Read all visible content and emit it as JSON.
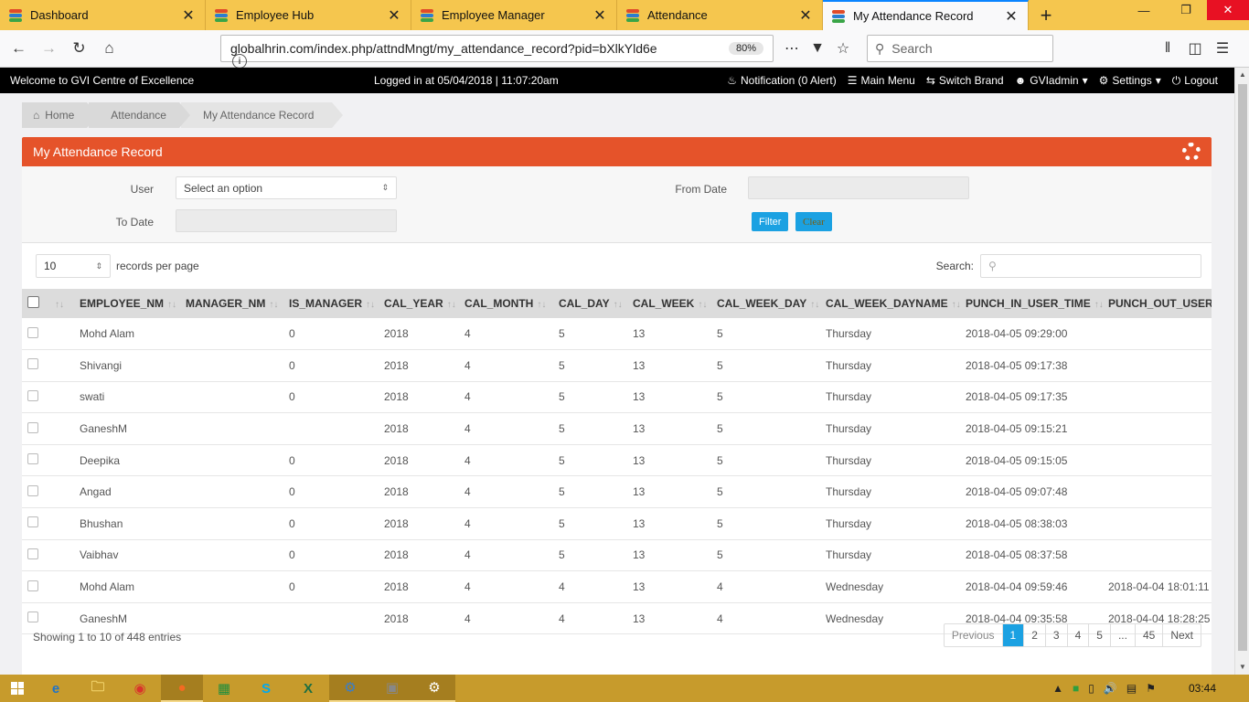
{
  "browser": {
    "tabs": [
      {
        "title": "Dashboard",
        "active": false
      },
      {
        "title": "Employee Hub",
        "active": false
      },
      {
        "title": "Employee Manager",
        "active": false
      },
      {
        "title": "Attendance",
        "active": false
      },
      {
        "title": "My Attendance Record",
        "active": true
      }
    ],
    "url": "globalhrin.com/index.php/attndMngt/my_attendance_record?pid=bXlkYld6e",
    "zoom": "80%",
    "search_placeholder": "Search"
  },
  "header": {
    "welcome": "Welcome to GVI Centre of Excellence",
    "logged_in": "Logged in at 05/04/2018 | 11:07:20am",
    "notification": "Notification (0 Alert)",
    "main_menu": "Main Menu",
    "switch_brand": "Switch Brand",
    "user": "GVIadmin",
    "settings": "Settings",
    "logout": "Logout"
  },
  "breadcrumb": [
    "Home",
    "Attendance",
    "My Attendance Record"
  ],
  "panel": {
    "title": "My Attendance Record",
    "accent": "#e5532a"
  },
  "filters": {
    "user_label": "User",
    "user_value": "Select an option",
    "from_label": "From Date",
    "to_label": "To Date",
    "filter_button": "Filter",
    "clear_button": "Clear"
  },
  "table": {
    "page_length": "10",
    "length_label": "records per page",
    "search_label": "Search:",
    "columns": [
      "EMPLOYEE_NM",
      "MANAGER_NM",
      "IS_MANAGER",
      "CAL_YEAR",
      "CAL_MONTH",
      "CAL_DAY",
      "CAL_WEEK",
      "CAL_WEEK_DAY",
      "CAL_WEEK_DAYNAME",
      "PUNCH_IN_USER_TIME",
      "PUNCH_OUT_USER_T"
    ],
    "rows": [
      [
        "Mohd Alam",
        "",
        "0",
        "2018",
        "4",
        "5",
        "13",
        "5",
        "Thursday",
        "2018-04-05 09:29:00",
        ""
      ],
      [
        "Shivangi",
        "",
        "0",
        "2018",
        "4",
        "5",
        "13",
        "5",
        "Thursday",
        "2018-04-05 09:17:38",
        ""
      ],
      [
        "swati",
        "",
        "0",
        "2018",
        "4",
        "5",
        "13",
        "5",
        "Thursday",
        "2018-04-05 09:17:35",
        ""
      ],
      [
        "GaneshM",
        "",
        "",
        "2018",
        "4",
        "5",
        "13",
        "5",
        "Thursday",
        "2018-04-05 09:15:21",
        ""
      ],
      [
        "Deepika",
        "",
        "0",
        "2018",
        "4",
        "5",
        "13",
        "5",
        "Thursday",
        "2018-04-05 09:15:05",
        ""
      ],
      [
        "Angad",
        "",
        "0",
        "2018",
        "4",
        "5",
        "13",
        "5",
        "Thursday",
        "2018-04-05 09:07:48",
        ""
      ],
      [
        "Bhushan",
        "",
        "0",
        "2018",
        "4",
        "5",
        "13",
        "5",
        "Thursday",
        "2018-04-05 08:38:03",
        ""
      ],
      [
        "Vaibhav",
        "",
        "0",
        "2018",
        "4",
        "5",
        "13",
        "5",
        "Thursday",
        "2018-04-05 08:37:58",
        ""
      ],
      [
        "Mohd Alam",
        "",
        "0",
        "2018",
        "4",
        "4",
        "13",
        "4",
        "Wednesday",
        "2018-04-04 09:59:46",
        "2018-04-04 18:01:11"
      ],
      [
        "GaneshM",
        "",
        "",
        "2018",
        "4",
        "4",
        "13",
        "4",
        "Wednesday",
        "2018-04-04 09:35:58",
        "2018-04-04 18:28:25"
      ]
    ],
    "info": "Showing 1 to 10 of 448 entries",
    "pager": [
      "Previous",
      "1",
      "2",
      "3",
      "4",
      "5",
      "...",
      "45",
      "Next"
    ],
    "current_page": "1"
  },
  "taskbar": {
    "clock": "03:44"
  }
}
